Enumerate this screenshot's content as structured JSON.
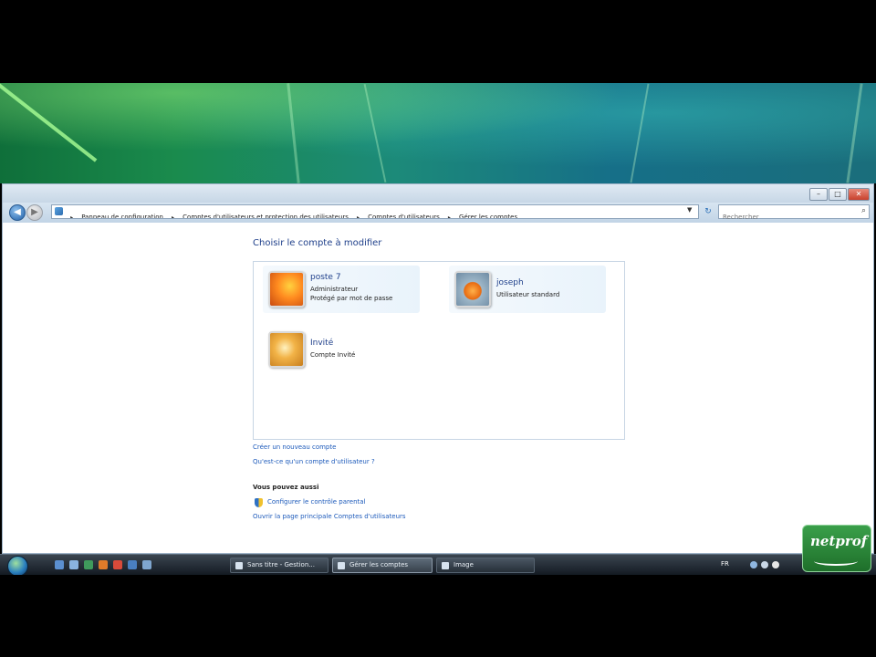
{
  "window": {
    "breadcrumb": [
      "Panneau de configuration",
      "Comptes d'utilisateurs et protection des utilisateurs",
      "Comptes d'utilisateurs",
      "Gérer les comptes"
    ],
    "search_placeholder": "Rechercher"
  },
  "page": {
    "title": "Choisir le compte à modifier",
    "accounts": [
      {
        "name": "poste 7",
        "role": "Administrateur",
        "status": "Protégé par mot de passe"
      },
      {
        "name": "joseph",
        "role": "Utilisateur standard",
        "status": ""
      },
      {
        "name": "Invité",
        "role": "Compte Invité",
        "status": ""
      }
    ],
    "link_create": "Créer un nouveau compte",
    "link_what": "Qu'est-ce qu'un compte d'utilisateur ?",
    "section_heading": "Vous pouvez aussi",
    "link_parental": "Configurer le contrôle parental",
    "link_main": "Ouvrir la page principale Comptes d'utilisateurs"
  },
  "taskbar": {
    "tasks": [
      "Sans titre - Gestion...",
      "Gérer les comptes",
      "Image"
    ],
    "lang": "FR"
  },
  "watermark": {
    "logo_text": "netprof"
  }
}
